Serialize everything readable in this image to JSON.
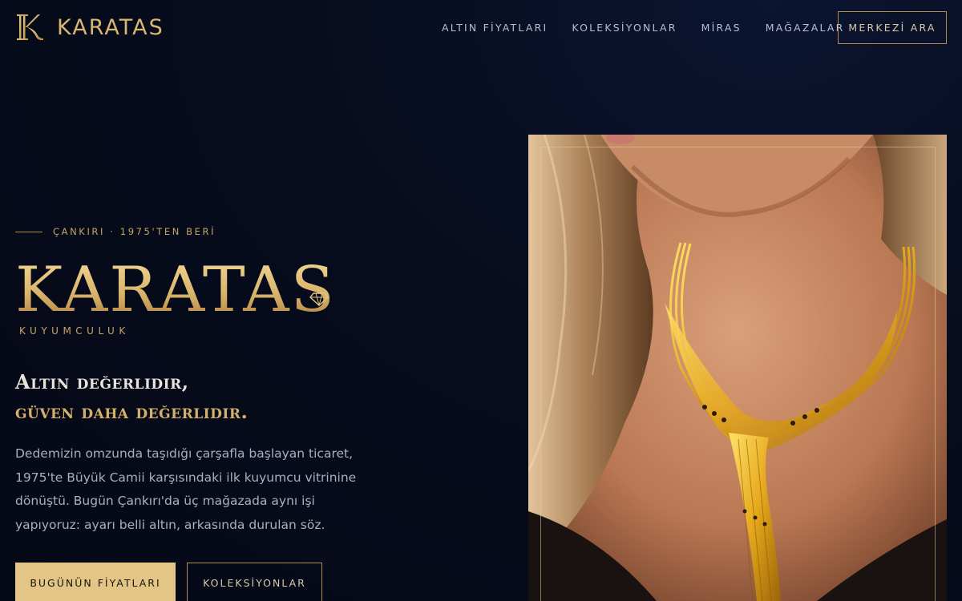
{
  "header": {
    "logo_text": "KARATAS",
    "nav": [
      {
        "label": "ALTIN FİYATLARI"
      },
      {
        "label": "KOLEKSİYONLAR"
      },
      {
        "label": "MİRAS"
      },
      {
        "label": "MAĞAZALAR"
      }
    ],
    "cta_label": "MERKEZİ ARA"
  },
  "hero": {
    "eyebrow": "ÇANKIRI · 1975'TEN BERİ",
    "brand": "KARATAS",
    "brand_sub": "KUYUMCULUK",
    "tagline_line1": "Altın değerlidir,",
    "tagline_line2": "güven daha değerlidir.",
    "lead": "Dedemizin omzunda taşıdığı çarşafla başlayan ticaret, 1975'te Büyük Camii karşısındaki ilk kuyumcu vitrinine dönüştü. Bugün Çankırı'da üç mağazada aynı işi yapıyoruz: ayarı belli altın, arkasında durulan söz.",
    "primary_button": "BUGÜNÜN FİYATLARI",
    "secondary_button": "KOLEKSİYONLAR"
  },
  "colors": {
    "background": "#060b1b",
    "gold": "#d4b06a",
    "gold_button": "#e3c685",
    "text_muted": "#a9b0c0"
  },
  "icons": {
    "logo_mark": "k-monogram-icon",
    "brand_gem": "diamond-icon"
  },
  "image": {
    "subject": "hero-photo-gold-necklace"
  }
}
